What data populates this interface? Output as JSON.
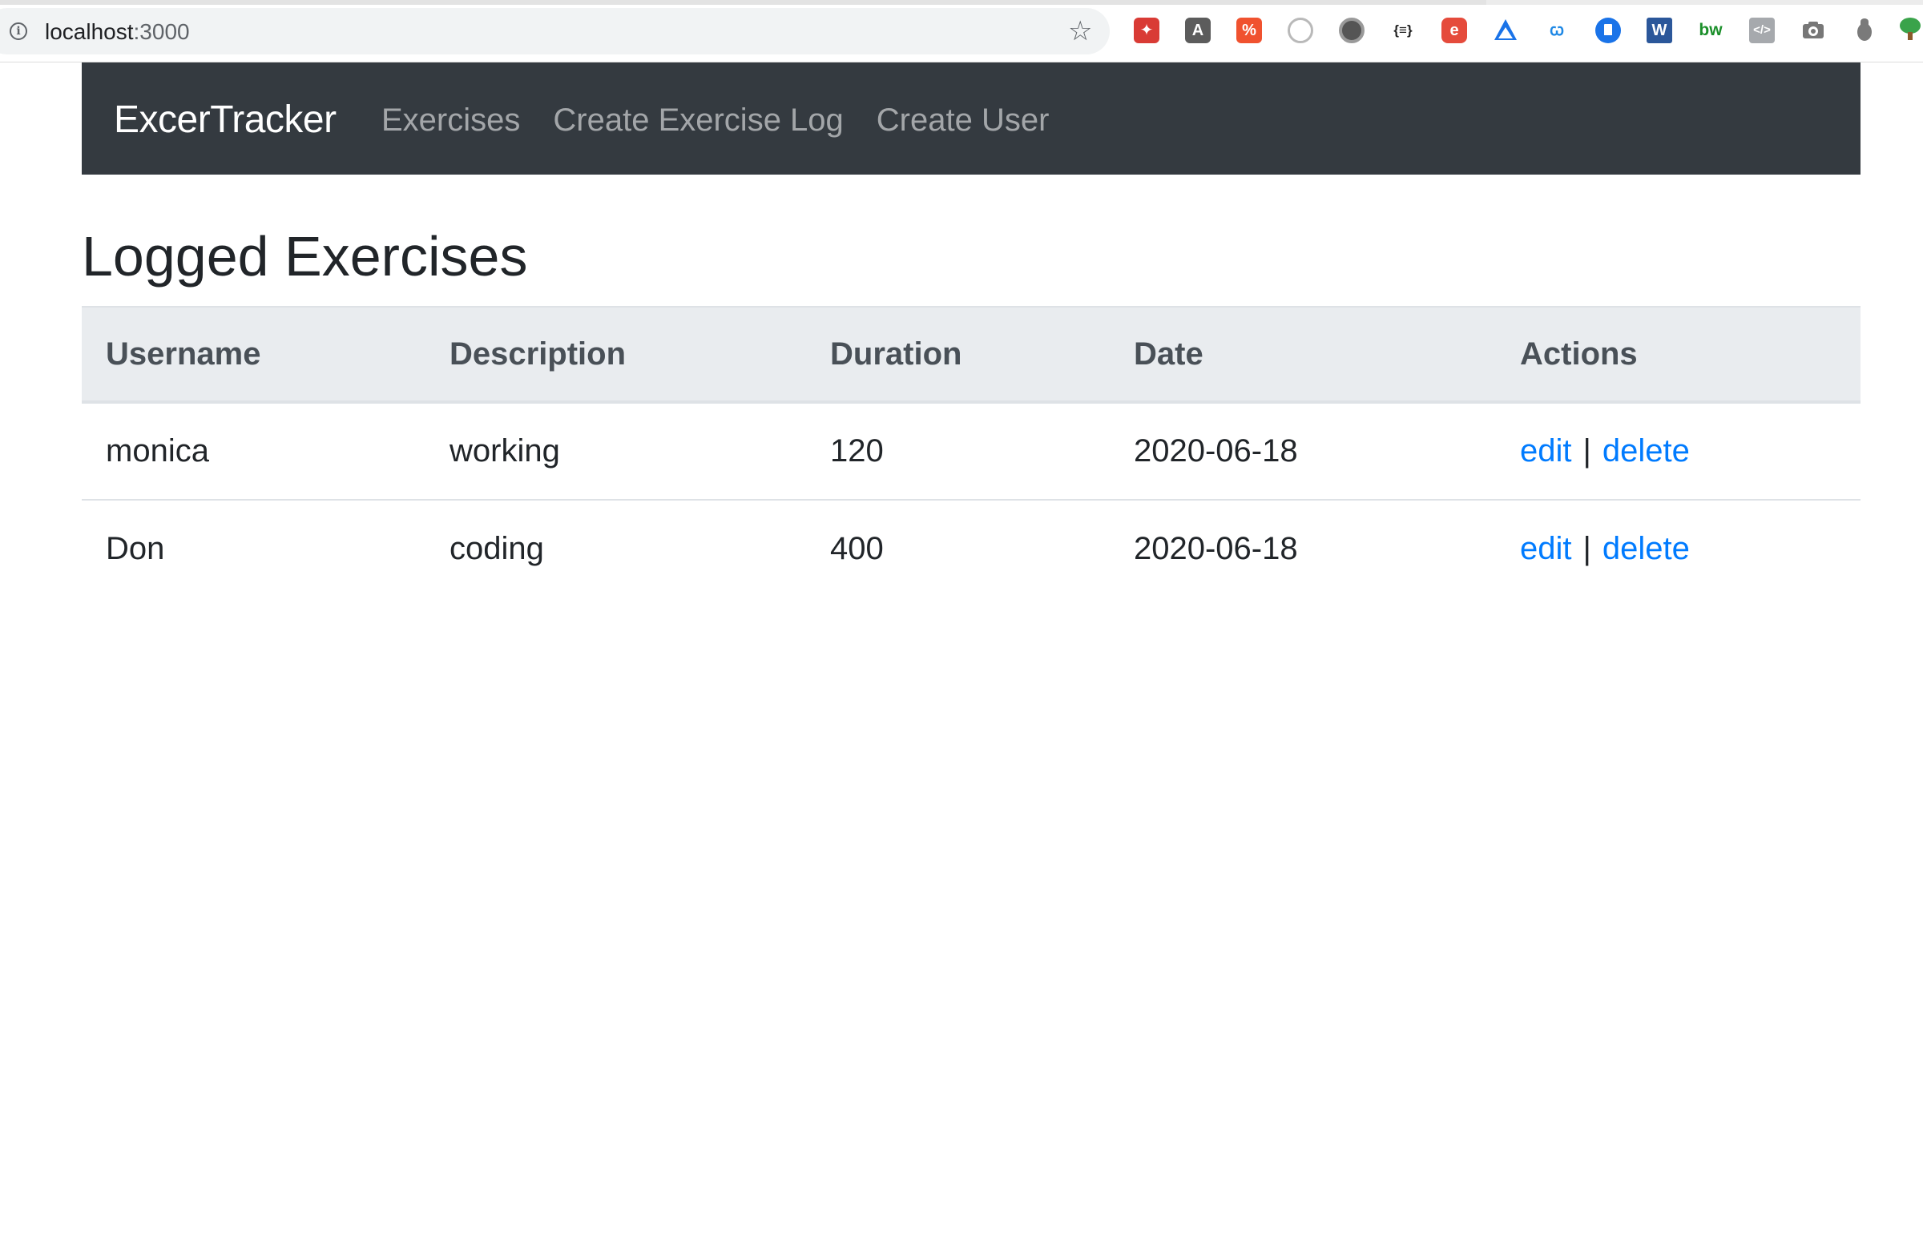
{
  "browser": {
    "url_host": "localhost",
    "url_port": ":3000",
    "extensions": [
      "pdf-tool-icon",
      "font-a-icon",
      "percent-icon",
      "circle-target-icon",
      "dark-circle-icon",
      "json-braces-icon",
      "e-icon",
      "ox-triangle-icon",
      "wb-icon",
      "bookmark-icon",
      "word-icon",
      "bw-icon",
      "code-icon",
      "camera-icon",
      "bug-icon",
      "tree-htm-icon"
    ]
  },
  "navbar": {
    "brand": "ExcerTracker",
    "links": [
      "Exercises",
      "Create Exercise Log",
      "Create User"
    ]
  },
  "page": {
    "title": "Logged Exercises"
  },
  "table": {
    "headers": [
      "Username",
      "Description",
      "Duration",
      "Date",
      "Actions"
    ],
    "rows": [
      {
        "username": "monica",
        "description": "working",
        "duration": "120",
        "date": "2020-06-18",
        "edit": "edit",
        "separator": "|",
        "delete": "delete"
      },
      {
        "username": "Don",
        "description": "coding",
        "duration": "400",
        "date": "2020-06-18",
        "edit": "edit",
        "separator": "|",
        "delete": "delete"
      }
    ]
  },
  "colors": {
    "navbar_bg": "#343a40",
    "link": "#007bff",
    "table_head_bg": "#e9ecef"
  }
}
